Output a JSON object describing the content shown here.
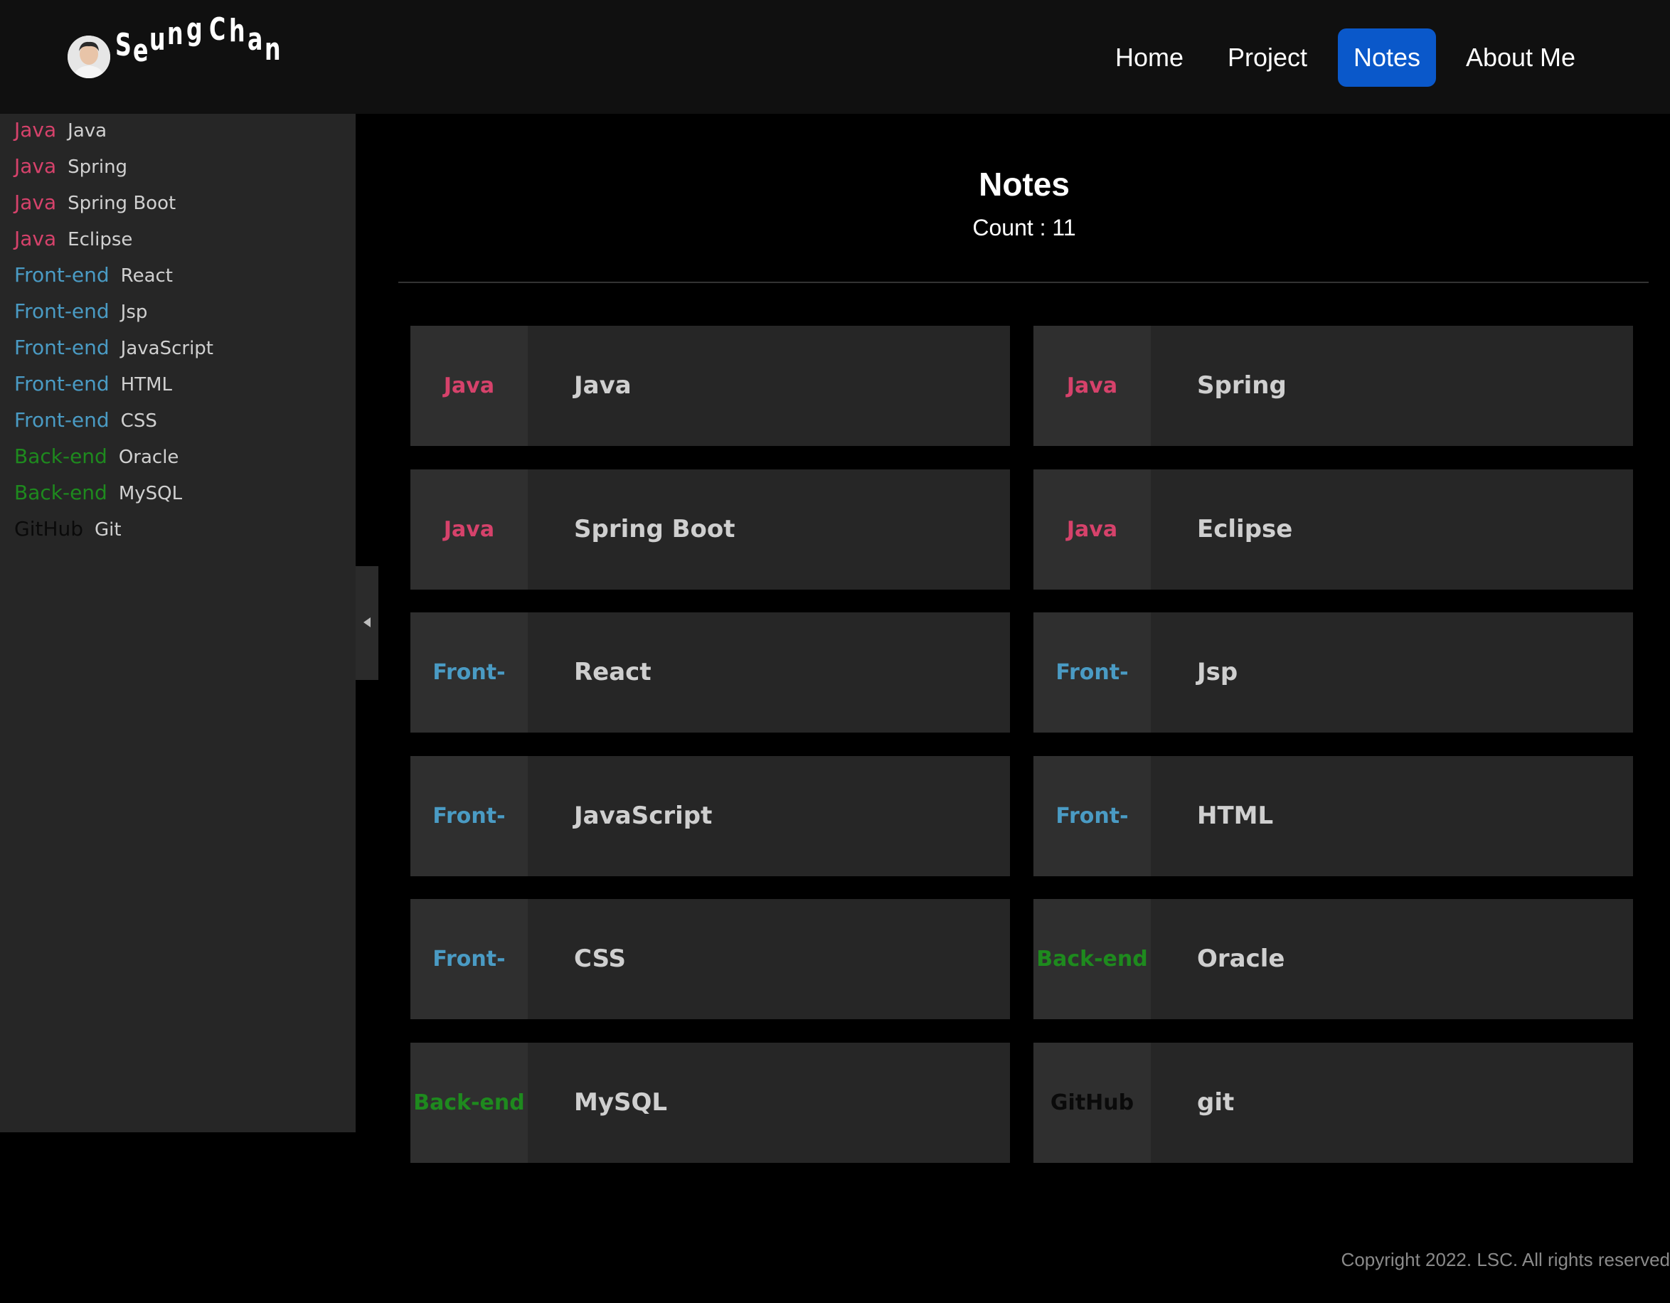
{
  "header": {
    "logo_text": "Seung Chan",
    "nav": [
      "Home",
      "Project",
      "Notes",
      "About Me"
    ],
    "active_nav": "Notes"
  },
  "category_colors": {
    "Java": "#d6426b",
    "Front-end": "#4a9bc4",
    "Back-end": "#1e8a1e",
    "GitHub": "#0a0a0a"
  },
  "sidebar": {
    "items": [
      {
        "category": "Java",
        "title": "Java"
      },
      {
        "category": "Java",
        "title": "Spring"
      },
      {
        "category": "Java",
        "title": "Spring Boot"
      },
      {
        "category": "Java",
        "title": "Eclipse"
      },
      {
        "category": "Front-end",
        "title": "React"
      },
      {
        "category": "Front-end",
        "title": "Jsp"
      },
      {
        "category": "Front-end",
        "title": "JavaScript"
      },
      {
        "category": "Front-end",
        "title": "HTML"
      },
      {
        "category": "Front-end",
        "title": "CSS"
      },
      {
        "category": "Back-end",
        "title": "Oracle"
      },
      {
        "category": "Back-end",
        "title": "MySQL"
      },
      {
        "category": "GitHub",
        "title": "Git"
      }
    ],
    "toggle_icon": "caret-left-icon"
  },
  "main": {
    "title": "Notes",
    "count_text": "Count : 11",
    "cards": [
      {
        "category": "Java",
        "title": "Java"
      },
      {
        "category": "Java",
        "title": "Spring"
      },
      {
        "category": "Java",
        "title": "Spring Boot"
      },
      {
        "category": "Java",
        "title": "Eclipse"
      },
      {
        "category": "Front-end",
        "title": "React"
      },
      {
        "category": "Front-end",
        "title": "Jsp"
      },
      {
        "category": "Front-end",
        "title": "JavaScript"
      },
      {
        "category": "Front-end",
        "title": "HTML"
      },
      {
        "category": "Front-end",
        "title": "CSS"
      },
      {
        "category": "Back-end",
        "title": "Oracle"
      },
      {
        "category": "Back-end",
        "title": "MySQL"
      },
      {
        "category": "GitHub",
        "title": "git"
      }
    ]
  },
  "footer": {
    "text": "Copyright 2022. LSC. All rights reserved"
  }
}
